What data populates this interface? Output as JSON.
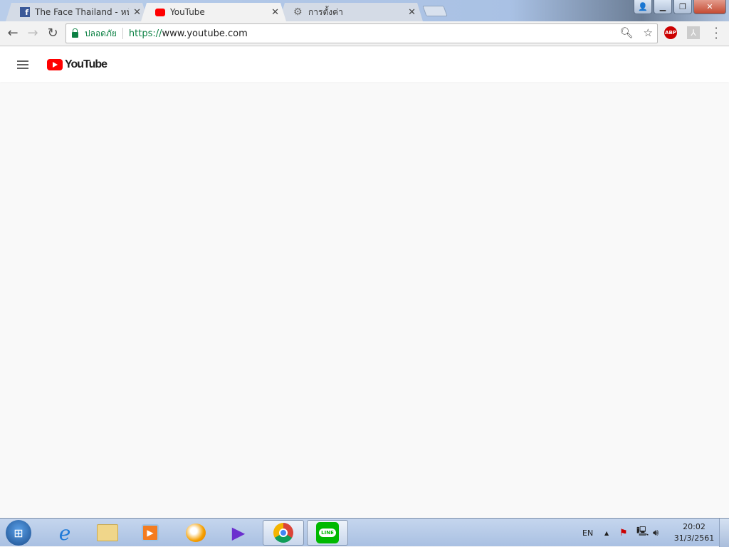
{
  "browser": {
    "tabs": [
      {
        "label": "The Face Thailand - หน้าห",
        "icon": "facebook-icon",
        "active": false
      },
      {
        "label": "YouTube",
        "icon": "youtube-icon",
        "active": true
      },
      {
        "label": "การตั้งค่า",
        "icon": "gear-icon",
        "active": false
      }
    ],
    "close_glyph": "✕",
    "address": {
      "secure_label": "ปลอดภัย",
      "scheme": "https://",
      "host": "www.youtube.com"
    },
    "extensions": {
      "abp": "ABP",
      "pdf": "⅄"
    }
  },
  "youtube": {
    "logo_text": "YouTube"
  },
  "taskbar": {
    "apps": [
      "internet-explorer",
      "file-explorer",
      "media-player",
      "gom-player",
      "visual-studio",
      "chrome",
      "line"
    ],
    "line_label": "LINE",
    "language": "EN",
    "time": "20:02",
    "date": "31/3/2561"
  },
  "colors": {
    "youtube_red": "#ff0000",
    "secure_green": "#0b8043",
    "line_green": "#00b900"
  }
}
